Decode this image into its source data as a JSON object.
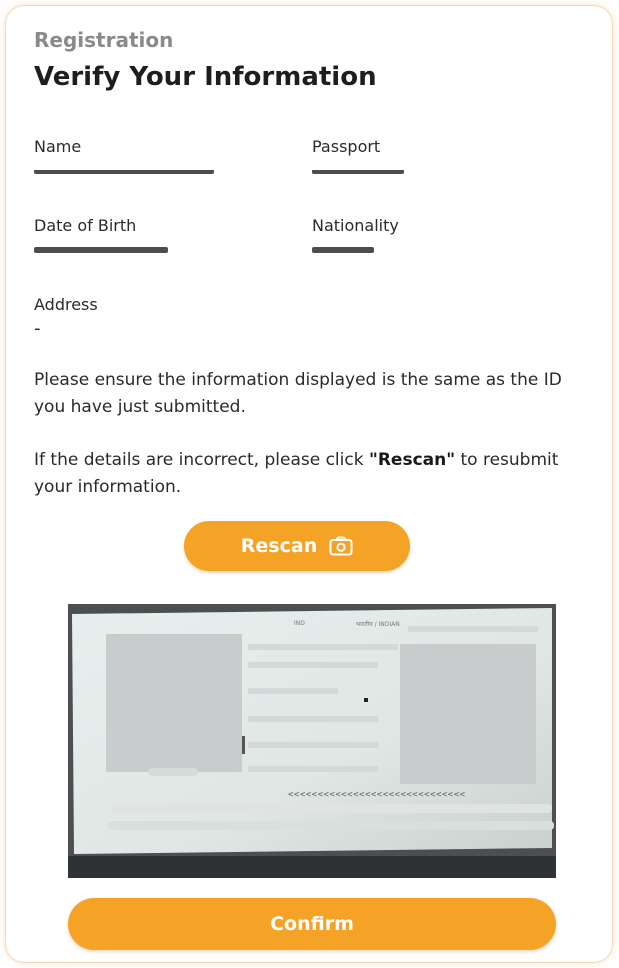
{
  "header": {
    "section": "Registration",
    "title": "Verify Your Information"
  },
  "fields": {
    "name": {
      "label": "Name"
    },
    "passport": {
      "label": "Passport"
    },
    "dob": {
      "label": "Date of Birth"
    },
    "nationality": {
      "label": "Nationality"
    },
    "address": {
      "label": "Address",
      "value": "-"
    }
  },
  "notice": {
    "line1": "Please ensure the information displayed is the same as the ID you have just submitted.",
    "line2_before": "If the details are incorrect, please click ",
    "line2_bold": "\"Rescan\"",
    "line2_after": " to resubmit your information."
  },
  "rescan": {
    "label": "Rescan",
    "icon": "camera-icon"
  },
  "document": {
    "nationality_text": "भारतीय / INDIAN",
    "code_text": "IND",
    "mrz": "<<<<<<<<<<<<<<<<<<<<<<<<<<<<<<"
  },
  "confirm": {
    "label": "Confirm"
  },
  "colors": {
    "accent": "#f5a327",
    "muted": "#8a8a8a"
  }
}
